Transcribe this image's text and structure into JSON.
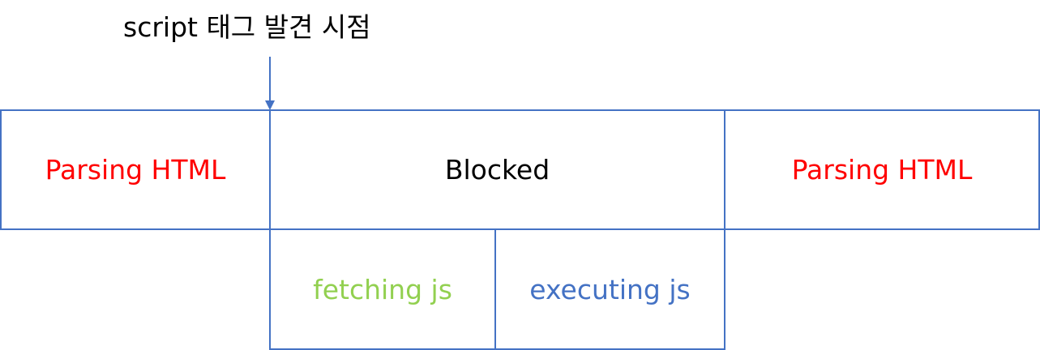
{
  "caption": "script 태그 발견 시점",
  "top_row": {
    "left_label": "Parsing HTML",
    "middle_label": "Blocked",
    "right_label": "Parsing HTML"
  },
  "bottom_row": {
    "fetch_label": "fetching js",
    "execute_label": "executing js"
  },
  "colors": {
    "border": "#4472C4",
    "parsing": "#FF0000",
    "blocked": "#000000",
    "fetching": "#92D050",
    "executing": "#4472C4"
  }
}
